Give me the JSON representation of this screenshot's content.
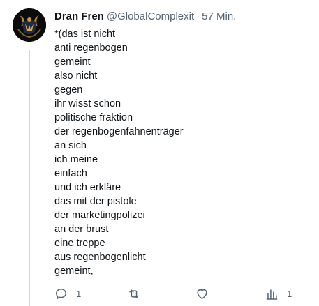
{
  "post": {
    "author_name": "Dran Fren",
    "author_handle": "@GlobalComplexit",
    "separator": "·",
    "timestamp": "57 Min.",
    "lines": [
      "*(das ist nicht",
      "anti regenbogen",
      "gemeint",
      "also nicht",
      "gegen",
      "ihr wisst schon",
      "politische fraktion",
      "der regenbogenfahnenträger",
      "an sich",
      "ich meine",
      "einfach",
      "und ich erkläre",
      "das mit der pistole",
      "der marketingpolizei",
      "an der brust",
      "eine treppe",
      "aus regenbogenlicht",
      "gemeint,"
    ]
  },
  "actions": {
    "reply_icon": "reply-icon",
    "reply_count": "1",
    "repost_icon": "repost-icon",
    "like_icon": "heart-icon",
    "views_icon": "views-chart-icon",
    "views_count": "1"
  },
  "colors": {
    "text": "#0f1419",
    "muted": "#536471",
    "thread_line": "#cfd9de"
  }
}
